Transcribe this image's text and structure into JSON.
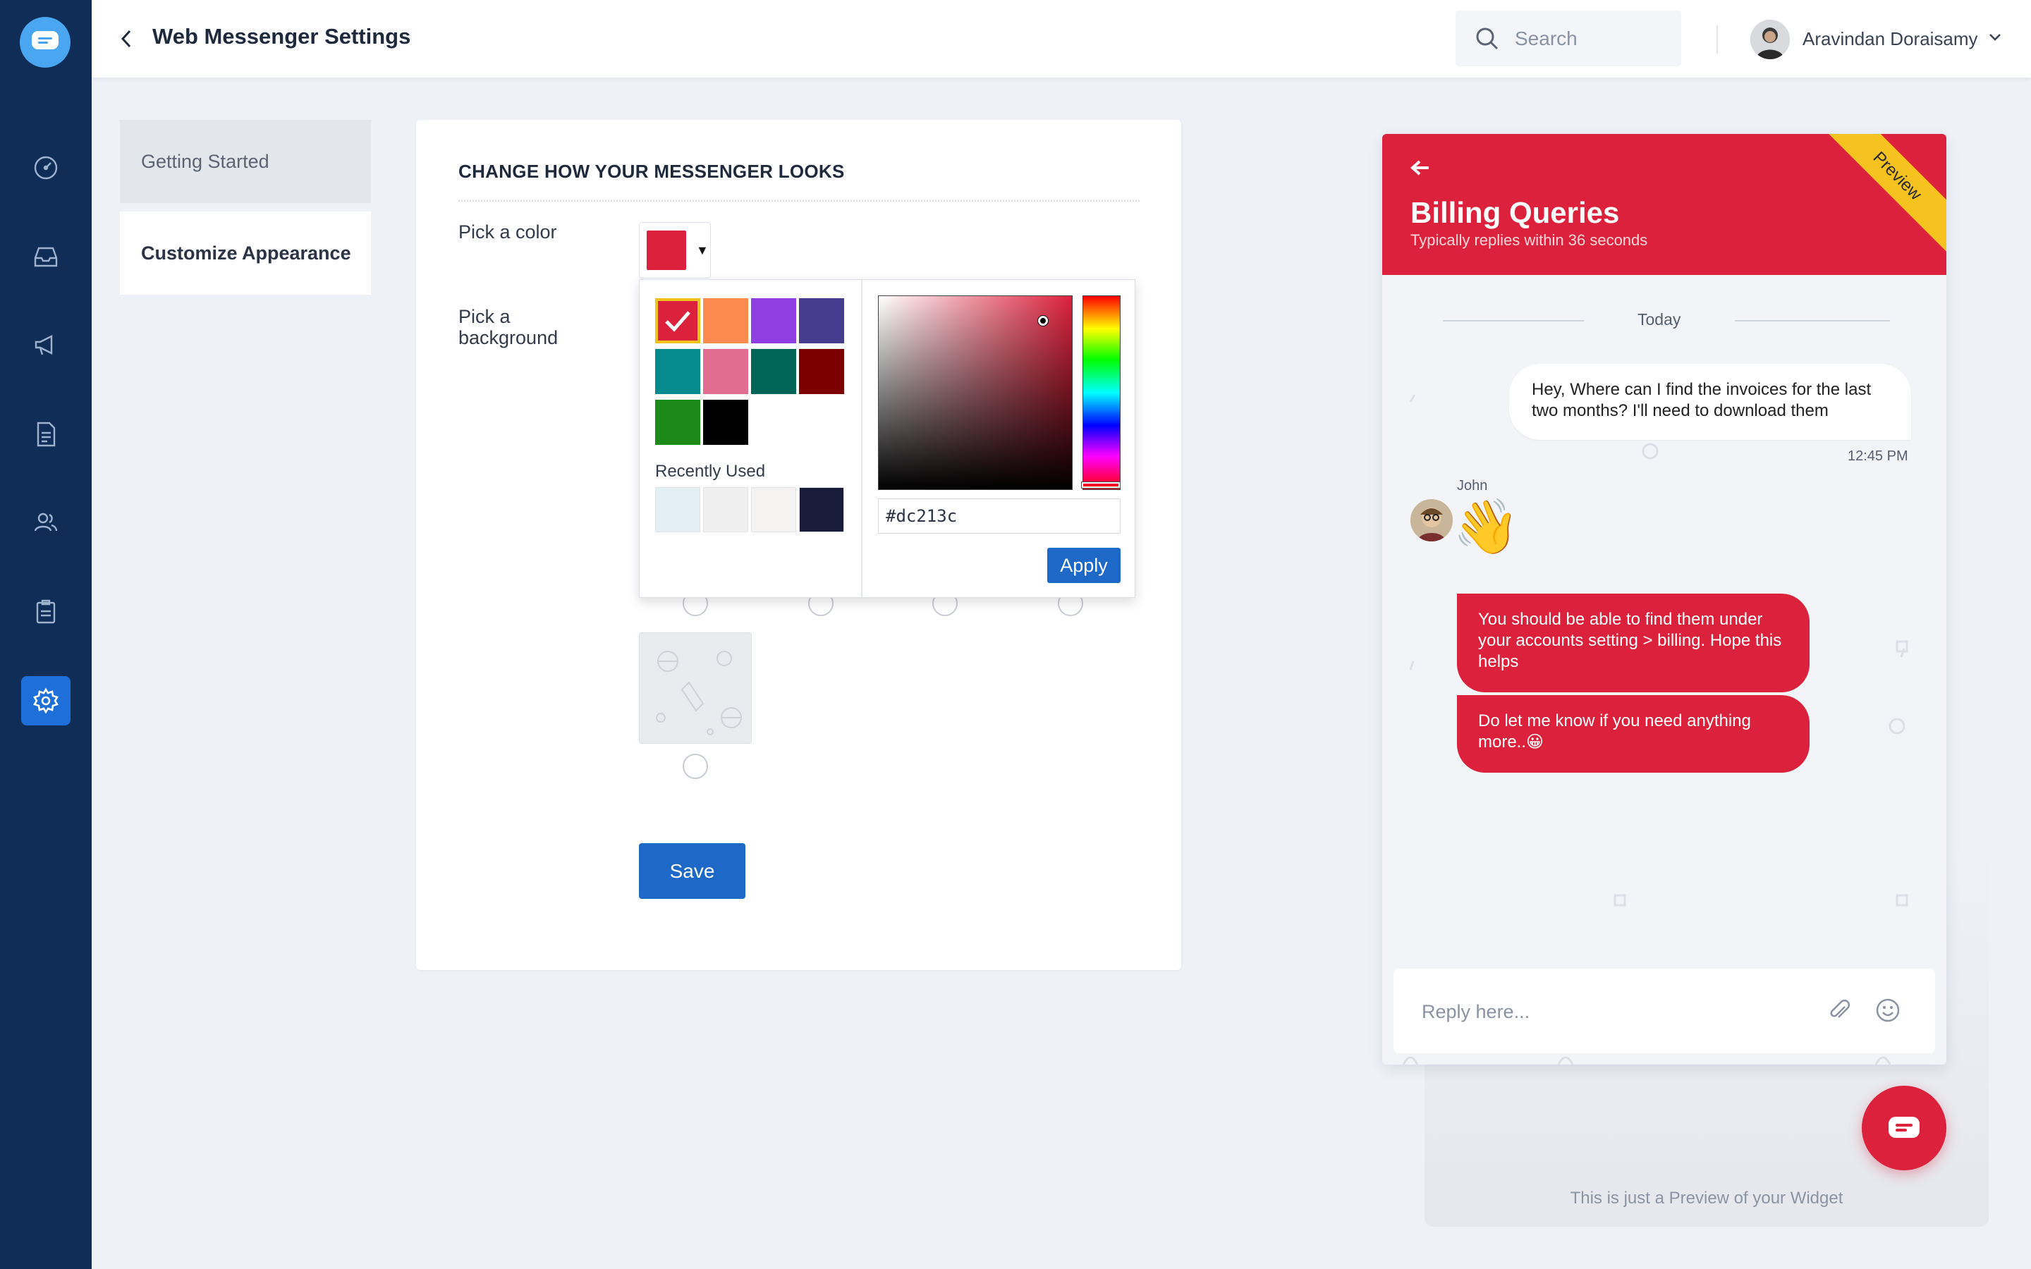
{
  "app": {
    "brand_color": "#1e68c8"
  },
  "rail": {
    "items": [
      {
        "icon": "dashboard-icon"
      },
      {
        "icon": "inbox-icon"
      },
      {
        "icon": "campaign-icon"
      },
      {
        "icon": "document-icon"
      },
      {
        "icon": "contacts-icon"
      },
      {
        "icon": "reports-icon"
      },
      {
        "icon": "settings-icon",
        "active": true
      }
    ]
  },
  "header": {
    "title": "Web Messenger Settings",
    "search_placeholder": "Search",
    "user_name": "Aravindan Doraisamy"
  },
  "subnav": {
    "items": [
      {
        "label": "Getting Started"
      },
      {
        "label": "Customize Appearance",
        "active": true
      }
    ]
  },
  "card": {
    "title": "CHANGE HOW YOUR MESSENGER LOOKS",
    "pick_color_label": "Pick a color",
    "pick_background_label": "Pick a background",
    "selected_color": "#dc213c",
    "save_label": "Save"
  },
  "picker": {
    "swatches": [
      "#dc213c",
      "#fd8a4e",
      "#8f3fe1",
      "#463d8e",
      "#078a8e",
      "#e26d93",
      "#006557",
      "#7c0000",
      "#1b8a18",
      "#000000"
    ],
    "recent_label": "Recently Used",
    "recent": [
      "#e2eff5",
      "#efefef",
      "#f5f2f2",
      "#181c3a"
    ],
    "hex_value": "#dc213c",
    "apply_label": "Apply"
  },
  "preview": {
    "header_color": "#dc213c",
    "title": "Billing Queries",
    "subtitle": "Typically replies within 36 seconds",
    "ribbon": "Preview",
    "divider_label": "Today",
    "user_message": "Hey, Where can I find the invoices for the last two months? I'll need to download them",
    "user_time": "12:45 PM",
    "agent_name": "John",
    "wave_emoji": "👋",
    "agent_messages": [
      "You should be able to find them under your accounts setting > billing. Hope this helps",
      "Do let me know if you need anything more..😀"
    ],
    "reply_placeholder": "Reply here...",
    "footer_note": "This is just a Preview of your Widget"
  }
}
